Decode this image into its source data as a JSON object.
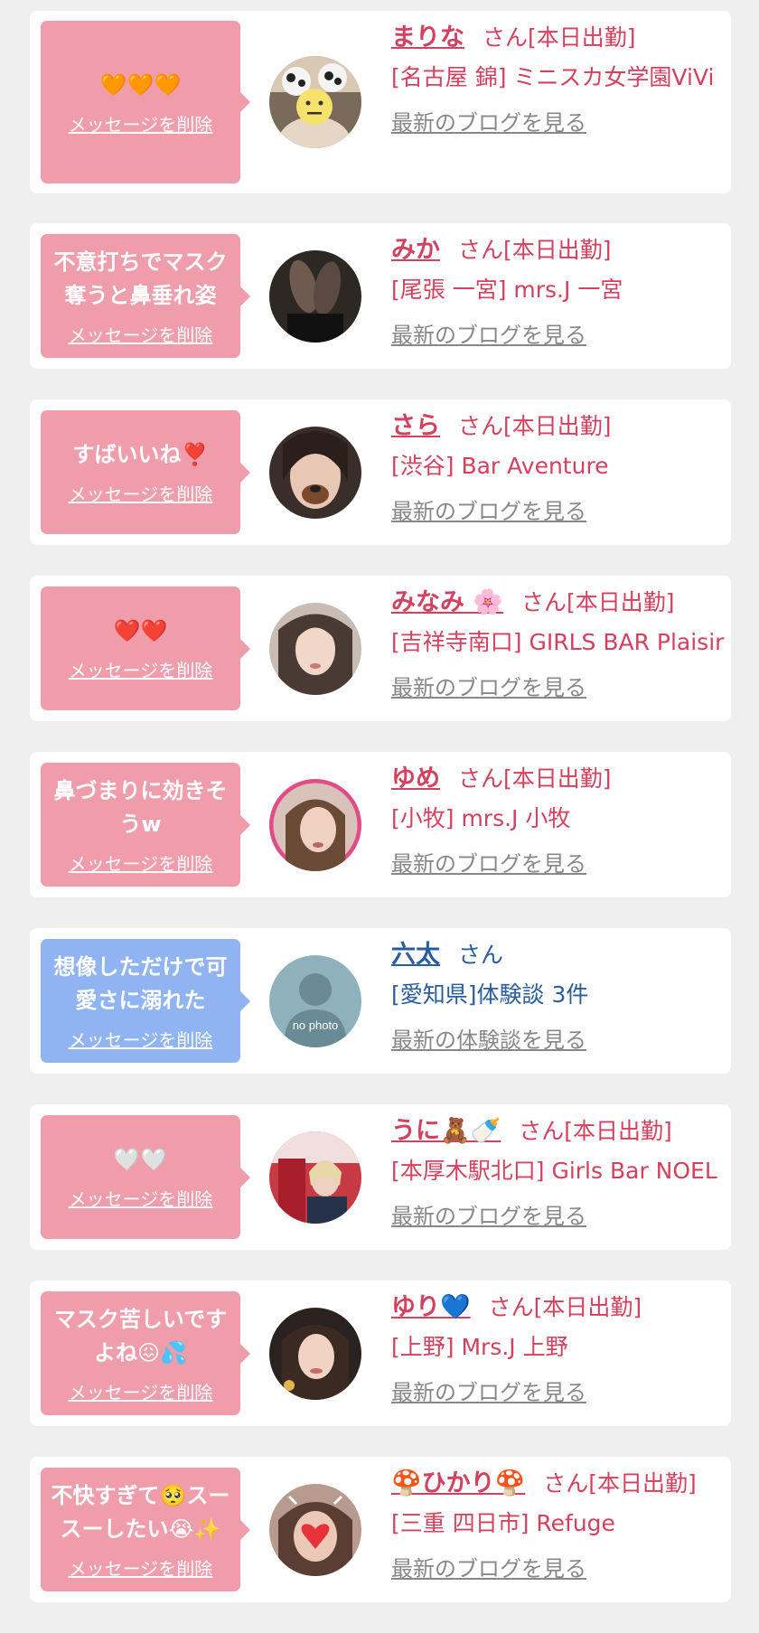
{
  "delete_label": "メッセージを削除",
  "cards": [
    {
      "message": "🧡🧡🧡",
      "name": "まりな",
      "suffix": "さん[本日出勤]",
      "shop": "[名古屋 錦] ミニスカ女学園ViVi",
      "link": "最新のブログを見る"
    },
    {
      "message": "不意打ちでマスク奪うと鼻垂れ姿",
      "name": "みか",
      "suffix": "さん[本日出勤]",
      "shop": "[尾張 一宮] mrs.J 一宮",
      "link": "最新のブログを見る"
    },
    {
      "message": "すばいいね❣️",
      "name": "さら",
      "suffix": "さん[本日出勤]",
      "shop": "[渋谷] Bar Aventure",
      "link": "最新のブログを見る"
    },
    {
      "message": "❤️❤️",
      "name": "みなみ 🌸",
      "suffix": "さん[本日出勤]",
      "shop": "[吉祥寺南口] GIRLS BAR Plaisir",
      "link": "最新のブログを見る"
    },
    {
      "message": "鼻づまりに効きそうw",
      "name": "ゆめ",
      "suffix": "さん[本日出勤]",
      "shop": "[小牧] mrs.J 小牧",
      "link": "最新のブログを見る"
    },
    {
      "message": "想像しただけで可愛さに溺れた",
      "name": "六太",
      "suffix": "さん",
      "shop": "[愛知県]体験談 3件",
      "link": "最新の体験談を見る",
      "avatar_text": "no photo"
    },
    {
      "message": "🤍🤍",
      "name": "うに🧸🍼",
      "suffix": "さん[本日出勤]",
      "shop": "[本厚木駅北口] Girls Bar NOEL",
      "link": "最新のブログを見る"
    },
    {
      "message": "マスク苦しいですよね😖💦",
      "name": "ゆり💙",
      "suffix": "さん[本日出勤]",
      "shop": "[上野] Mrs.J 上野",
      "link": "最新のブログを見る"
    },
    {
      "message": "不快すぎて🥺スースーしたい😭✨",
      "name": "🍄ひかり🍄",
      "suffix": "さん[本日出勤]",
      "shop": "[三重 四日市] Refuge",
      "link": "最新のブログを見る"
    }
  ]
}
